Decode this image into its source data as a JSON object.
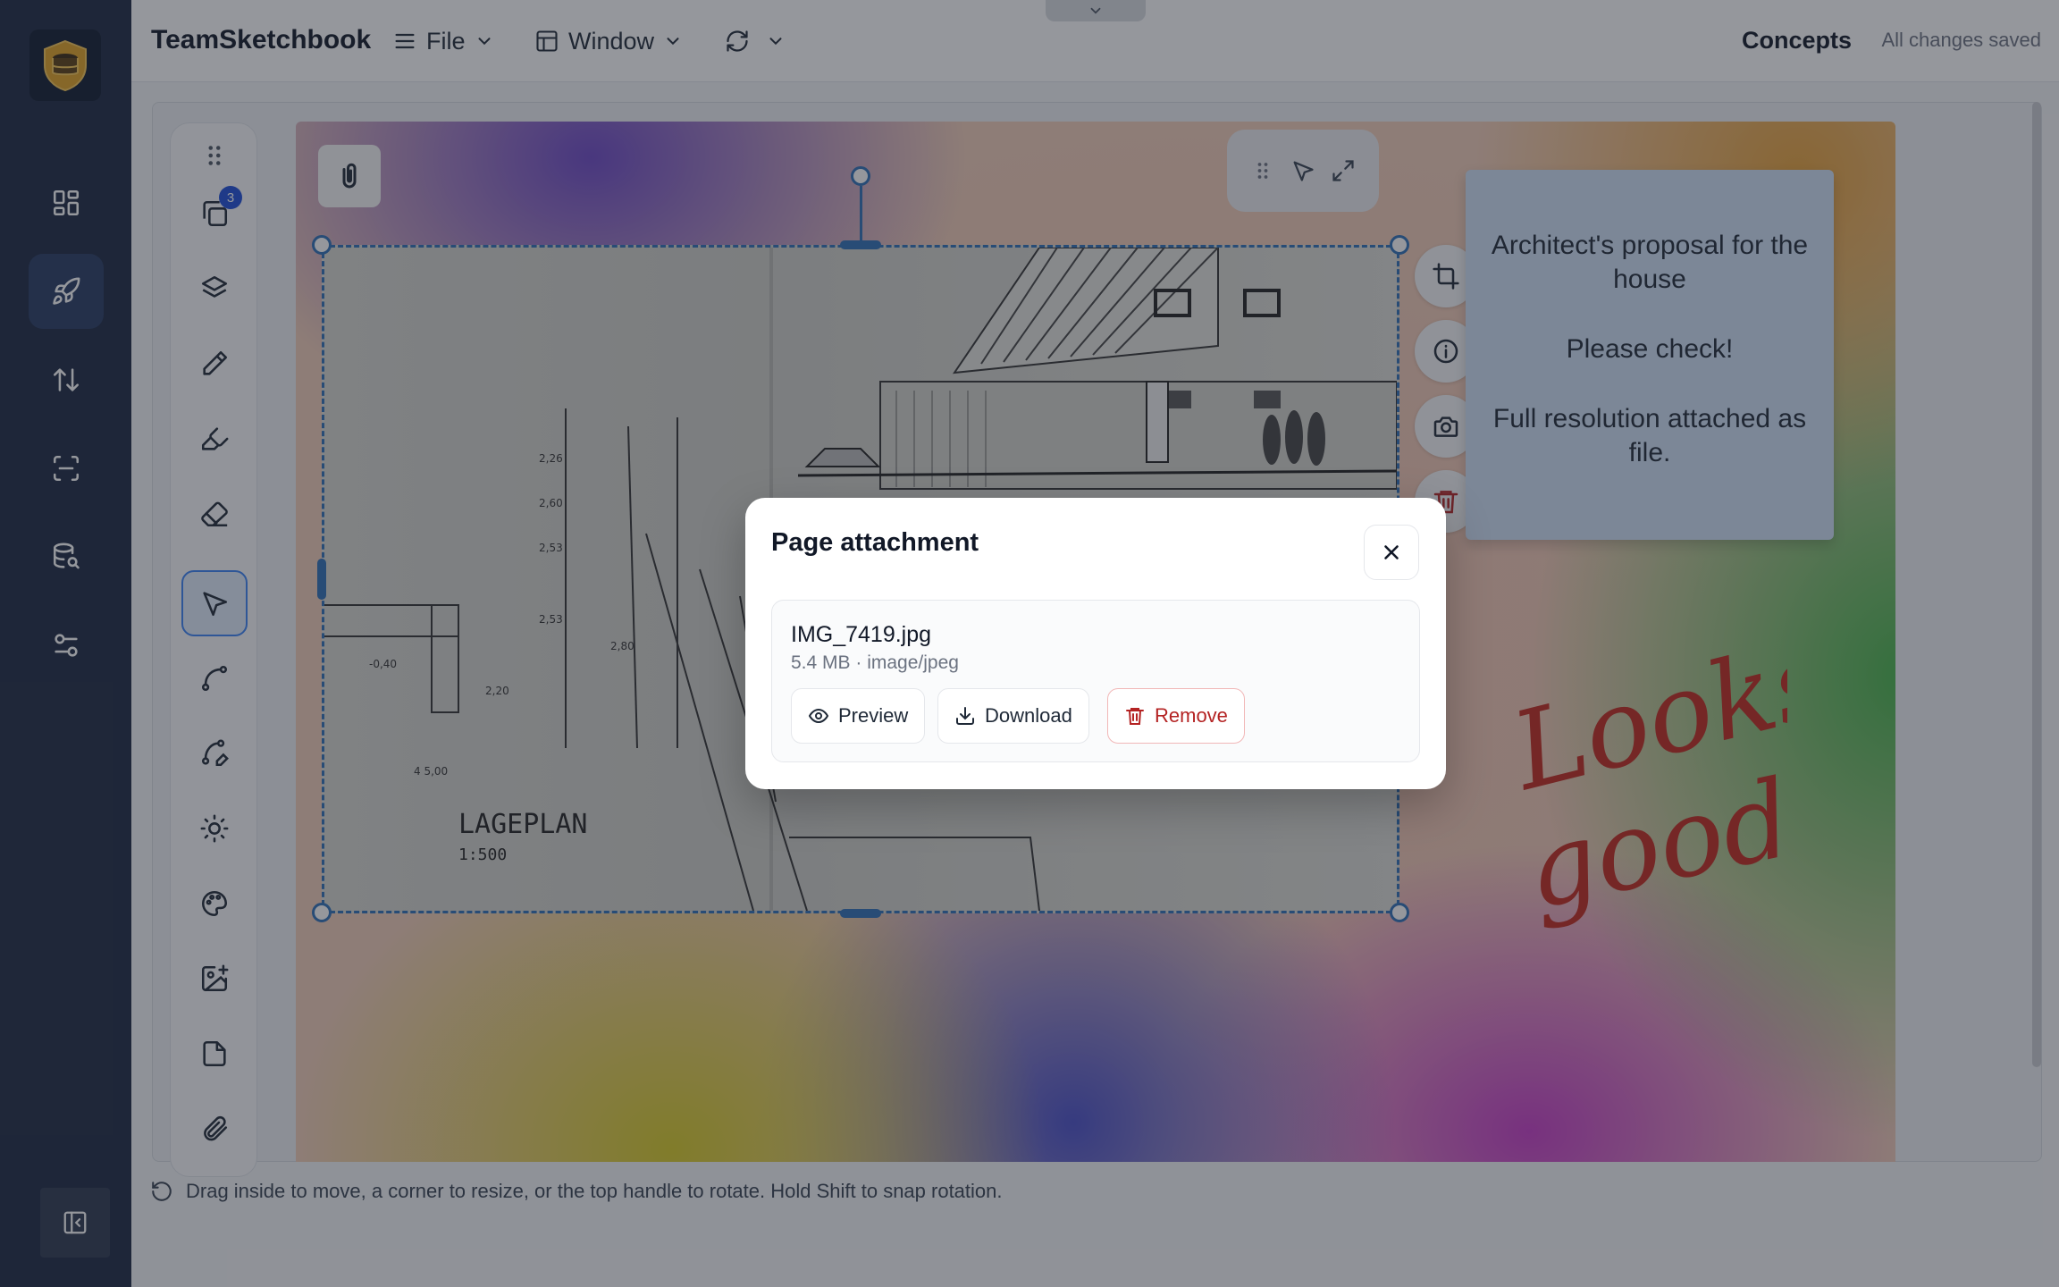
{
  "app": {
    "title": "TeamSketchbook",
    "menus": [
      {
        "label": "File"
      },
      {
        "label": "Window"
      }
    ],
    "project": "Concepts",
    "save_status": "All changes saved"
  },
  "toolbar": {
    "pages_badge": "3",
    "tools": [
      "drag-handle",
      "pages",
      "layers",
      "pencil",
      "marker",
      "eraser",
      "select",
      "curve",
      "curve-edit",
      "brightness",
      "palette",
      "add-image",
      "document",
      "attachment"
    ],
    "active_tool": "select"
  },
  "note": {
    "line1": "Architect's proposal for the house",
    "line2": "Please check!",
    "line3": "Full resolution attached as file."
  },
  "photo": {
    "caption_main": "LAGEPLAN",
    "caption_scale": "1:500"
  },
  "handwriting": {
    "line1": "Looks",
    "line2": "good!"
  },
  "status": {
    "hint": "Drag inside to move, a corner to resize, or the top handle to rotate. Hold Shift to snap rotation."
  },
  "modal": {
    "title": "Page attachment",
    "file": {
      "name": "IMG_7419.jpg",
      "meta": "5.4 MB · image/jpeg"
    },
    "actions": {
      "preview": "Preview",
      "download": "Download",
      "remove": "Remove"
    }
  },
  "colors": {
    "nav_bg": "#1c2841",
    "nav_active": "#273a63",
    "selection": "#2f6fb7",
    "danger": "#b42323",
    "note_bg": "#cfe0f5",
    "handwriting": "#c22a1d"
  }
}
